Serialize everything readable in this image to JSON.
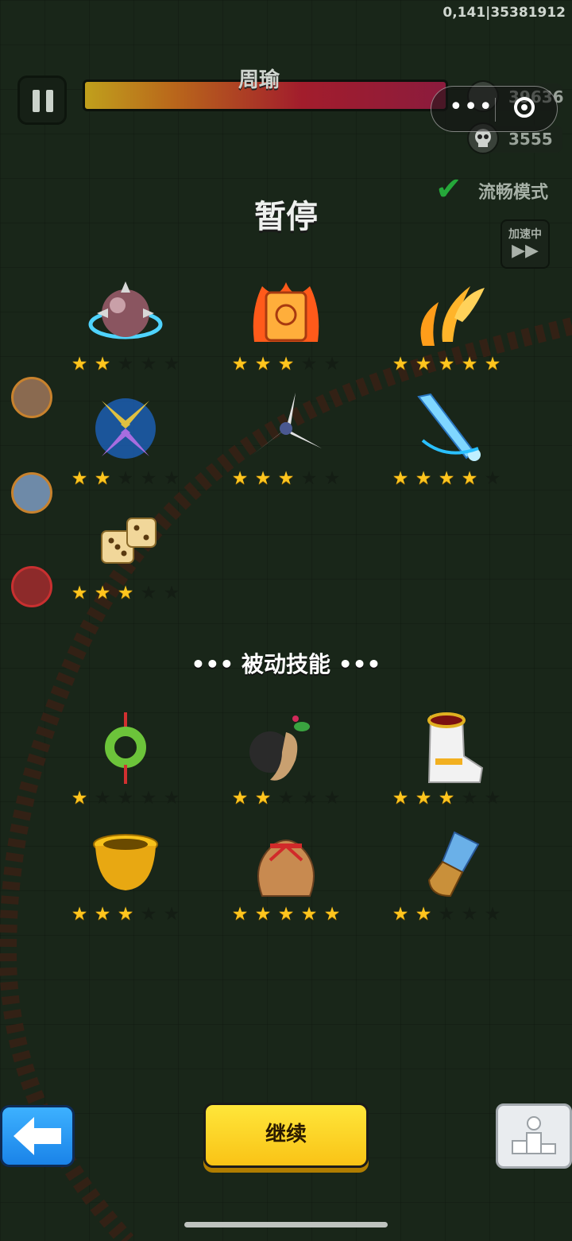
{
  "debug_info": "0,141|35381912",
  "boss": {
    "name": "周瑜"
  },
  "stats": {
    "coins": "39636",
    "kills": "3555"
  },
  "smooth_mode_label": "流畅模式",
  "speed_label": "加速中",
  "pause_title": "暂停",
  "passive_title": "被动技能",
  "passive_dots_left": "•••",
  "passive_dots_right": "•••",
  "continue_label": "继续",
  "capsule_dots": "•••",
  "active_skills": [
    {
      "icon": "spiked-iron-ball-icon",
      "stars": 2
    },
    {
      "icon": "fire-scroll-icon",
      "stars": 3
    },
    {
      "icon": "flame-feathers-icon",
      "stars": 5
    },
    {
      "icon": "spinning-swords-icon",
      "stars": 2
    },
    {
      "icon": "shuriken-blade-icon",
      "stars": 3
    },
    {
      "icon": "ice-sword-icon",
      "stars": 4
    },
    {
      "icon": "golden-dice-icon",
      "stars": 3
    }
  ],
  "passive_skills": [
    {
      "icon": "jade-pendant-icon",
      "stars": 1
    },
    {
      "icon": "ginseng-root-icon",
      "stars": 2
    },
    {
      "icon": "boot-icon",
      "stars": 3
    },
    {
      "icon": "golden-cauldron-icon",
      "stars": 3
    },
    {
      "icon": "treasure-bag-icon",
      "stars": 5
    },
    {
      "icon": "armored-gauntlet-icon",
      "stars": 2
    }
  ],
  "max_stars": 5,
  "colors": {
    "star_on": "#ffc51e",
    "star_off": "#141d14",
    "continue_btn": "#fcd426",
    "back_btn": "#2a9af5"
  }
}
